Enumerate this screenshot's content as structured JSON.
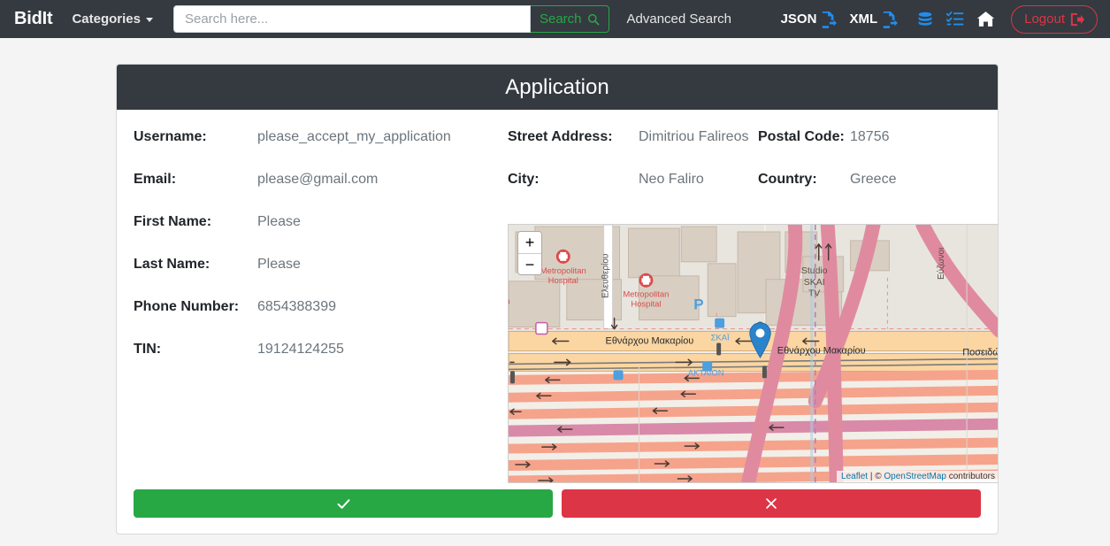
{
  "navbar": {
    "brand": "BidIt",
    "categories_label": "Categories",
    "search": {
      "placeholder": "Search here...",
      "value": "",
      "button_label": "Search",
      "button_icon": "search-icon"
    },
    "advanced_search_label": "Advanced Search",
    "export": [
      {
        "label": "JSON",
        "icon": "file-export-icon"
      },
      {
        "label": "XML",
        "icon": "file-export-icon"
      }
    ],
    "icons": [
      {
        "name": "database-icon",
        "color": "#1f8ef1"
      },
      {
        "name": "list-check-icon",
        "color": "#1f8ef1"
      },
      {
        "name": "home-icon",
        "color": "#ffffff"
      }
    ],
    "logout_label": "Logout",
    "logout_icon": "sign-out-icon",
    "colors": {
      "background": "#343a40",
      "accent_green": "#28a745",
      "accent_red": "#dc3545",
      "accent_blue": "#1f8ef1"
    }
  },
  "card": {
    "title": "Application"
  },
  "fields_left": [
    {
      "label": "Username:",
      "value": "please_accept_my_application"
    },
    {
      "label": "Email:",
      "value": "please@gmail.com"
    },
    {
      "label": "First Name:",
      "value": "Please"
    },
    {
      "label": "Last Name:",
      "value": "Please"
    },
    {
      "label": "Phone Number:",
      "value": "6854388399"
    },
    {
      "label": "TIN:",
      "value": "19124124255"
    }
  ],
  "fields_right": [
    {
      "label_a": "Street Address:",
      "value_a": "Dimitriou Falireos",
      "label_b": "Postal Code:",
      "value_b": "18756"
    },
    {
      "label_a": "City:",
      "value_a": "Neo Faliro",
      "label_b": "Country:",
      "value_b": "Greece"
    }
  ],
  "map": {
    "zoom_in_label": "+",
    "zoom_out_label": "−",
    "marker_icon": "map-pin-icon",
    "attribution": {
      "leaflet": "Leaflet",
      "separator": " | © ",
      "osm": "OpenStreetMap",
      "suffix": " contributors"
    },
    "labels": [
      {
        "text": "Metropolitan Hospital",
        "kind": "poi-hospital"
      },
      {
        "text": "Metropolitan Hospital",
        "kind": "poi-hospital"
      },
      {
        "text": "Studio SKAI TV",
        "kind": "building"
      },
      {
        "text": "Ελευθερίου",
        "kind": "street"
      },
      {
        "text": "Εθνάρχου Μακαρίου",
        "kind": "street"
      },
      {
        "text": "Εθνάρχου Μακαρίου",
        "kind": "street"
      },
      {
        "text": "Ποσειδώνος",
        "kind": "street"
      },
      {
        "text": "Εύζωνοι",
        "kind": "street"
      },
      {
        "text": "ΣΚΑΐ",
        "kind": "transit-stop"
      },
      {
        "text": "ΑΚΤΑΙΟΝ",
        "kind": "transit-stop"
      },
      {
        "text": "P",
        "kind": "parking"
      }
    ]
  },
  "actions": {
    "accept_icon": "check-icon",
    "reject_icon": "times-icon"
  }
}
